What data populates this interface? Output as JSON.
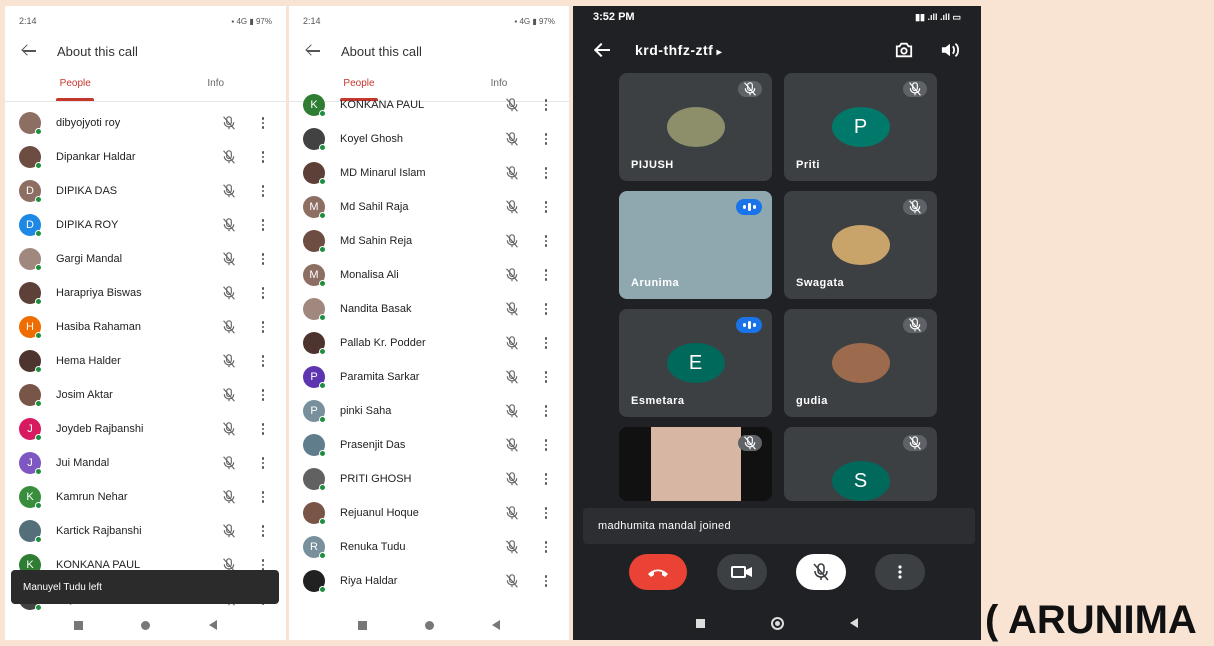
{
  "left_screen": {
    "status_time": "2:14",
    "status_right": "▪ 4G ▮ 97%",
    "title": "About this call",
    "tabs": [
      "People",
      "Info"
    ],
    "people": [
      {
        "name": "dibyojyoti roy",
        "initial": "",
        "color": "#8d6e63"
      },
      {
        "name": "Dipankar Haldar",
        "initial": "",
        "color": "#6d4c41"
      },
      {
        "name": "DIPIKA DAS",
        "initial": "D",
        "color": "#8d6e63"
      },
      {
        "name": "DIPIKA ROY",
        "initial": "D",
        "color": "#1e88e5"
      },
      {
        "name": "Gargi Mandal",
        "initial": "",
        "color": "#a1887f"
      },
      {
        "name": "Harapriya Biswas",
        "initial": "",
        "color": "#5d4037"
      },
      {
        "name": "Hasiba Rahaman",
        "initial": "H",
        "color": "#ef6c00"
      },
      {
        "name": "Hema Halder",
        "initial": "",
        "color": "#4e342e"
      },
      {
        "name": "Josim Aktar",
        "initial": "",
        "color": "#795548"
      },
      {
        "name": "Joydeb Rajbanshi",
        "initial": "J",
        "color": "#d81b60"
      },
      {
        "name": "Jui Mandal",
        "initial": "J",
        "color": "#7e57c2"
      },
      {
        "name": "Kamrun Nehar",
        "initial": "K",
        "color": "#388e3c"
      },
      {
        "name": "Kartick Rajbanshi",
        "initial": "",
        "color": "#546e7a"
      },
      {
        "name": "KONKANA PAUL",
        "initial": "K",
        "color": "#2e7d32"
      },
      {
        "name": "Koyel Ghosh",
        "initial": "",
        "color": "#424242"
      }
    ],
    "toast": "Manuyel Tudu left"
  },
  "middle_screen": {
    "status_time": "2:14",
    "status_right": "▪ 4G ▮ 97%",
    "title": "About this call",
    "tabs": [
      "People",
      "Info"
    ],
    "people": [
      {
        "name": "KONKANA PAUL",
        "initial": "K",
        "color": "#2e7d32"
      },
      {
        "name": "Koyel Ghosh",
        "initial": "",
        "color": "#424242"
      },
      {
        "name": "MD Minarul Islam",
        "initial": "",
        "color": "#5d4037"
      },
      {
        "name": "Md Sahil Raja",
        "initial": "M",
        "color": "#8d6e63"
      },
      {
        "name": "Md Sahin Reja",
        "initial": "",
        "color": "#6d4c41"
      },
      {
        "name": "Monalisa Ali",
        "initial": "M",
        "color": "#8d6e63"
      },
      {
        "name": "Nandita Basak",
        "initial": "",
        "color": "#a1887f"
      },
      {
        "name": "Pallab Kr. Podder",
        "initial": "",
        "color": "#4e342e"
      },
      {
        "name": "Paramita Sarkar",
        "initial": "P",
        "color": "#5e35b1"
      },
      {
        "name": "pinki Saha",
        "initial": "P",
        "color": "#78909c"
      },
      {
        "name": "Prasenjit Das",
        "initial": "",
        "color": "#607d8b"
      },
      {
        "name": "PRITI GHOSH",
        "initial": "",
        "color": "#616161"
      },
      {
        "name": "Rejuanul Hoque",
        "initial": "",
        "color": "#795548"
      },
      {
        "name": "Renuka Tudu",
        "initial": "R",
        "color": "#78909c"
      },
      {
        "name": "Riya Haldar",
        "initial": "",
        "color": "#212121"
      }
    ]
  },
  "meet_screen": {
    "status_time": "3:52 PM",
    "status_right": "▮▮ .ıll .ıll ▭",
    "meeting_code": "krd-thfz-ztf",
    "tiles": [
      {
        "name": "PIJUSH",
        "initial": "",
        "color": "#8d8f6a",
        "speaking": false
      },
      {
        "name": "Priti",
        "initial": "P",
        "color": "#00796b",
        "speaking": false
      },
      {
        "name": "Arunima",
        "initial": "",
        "color": "#8fa8b0",
        "speaking": true
      },
      {
        "name": "Swagata",
        "initial": "",
        "color": "#c9a46a",
        "speaking": false
      },
      {
        "name": "Esmetara",
        "initial": "E",
        "color": "#00695c",
        "speaking": true
      },
      {
        "name": "gudia",
        "initial": "",
        "color": "#9c6b4e",
        "speaking": false
      },
      {
        "name": "",
        "initial": "",
        "color": "#d7b7a3",
        "speaking": false
      },
      {
        "name": "",
        "initial": "S",
        "color": "#00695c",
        "speaking": false
      }
    ],
    "notice": "madhumita mandal joined",
    "colors": {
      "end_call": "#ea4335",
      "control": "#3c4043",
      "mic_off": "#ffffff"
    }
  },
  "caption": "( ARUNIMA"
}
